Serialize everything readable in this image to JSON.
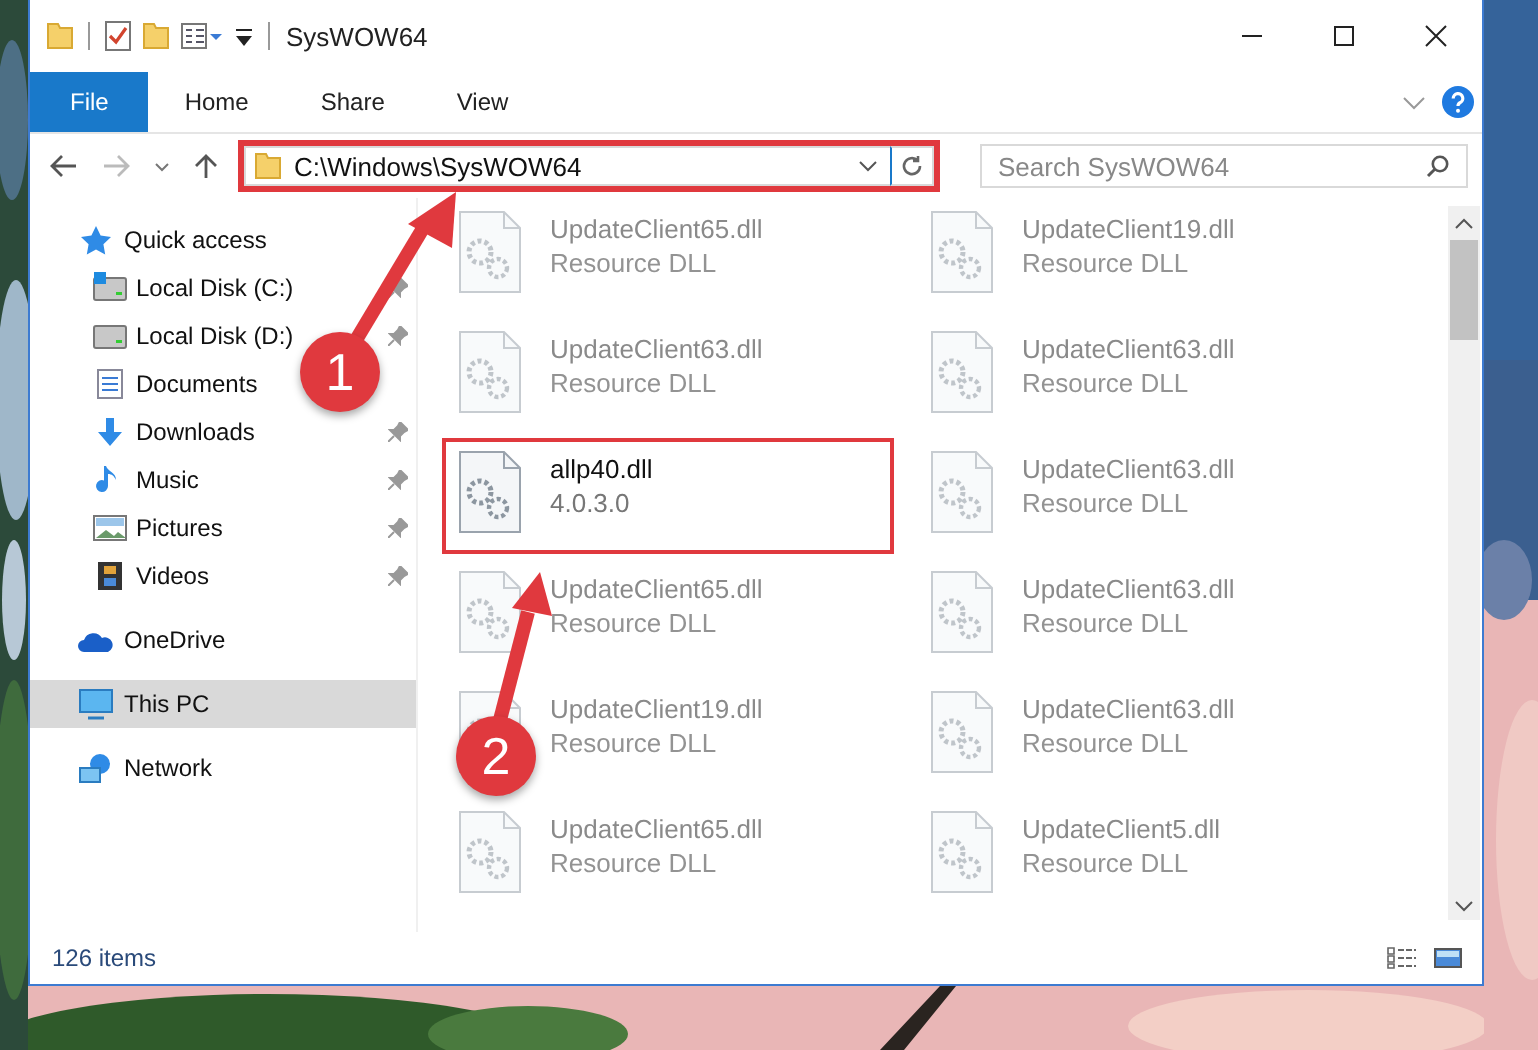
{
  "window": {
    "title": "SysWOW64"
  },
  "ribbon": {
    "tabs": [
      {
        "label": "File",
        "selected": true
      },
      {
        "label": "Home",
        "selected": false
      },
      {
        "label": "Share",
        "selected": false
      },
      {
        "label": "View",
        "selected": false
      }
    ]
  },
  "address_bar": {
    "path": "C:\\Windows\\SysWOW64",
    "highlighted": true
  },
  "search": {
    "placeholder": "Search SysWOW64"
  },
  "sidebar": {
    "items": [
      {
        "label": "Quick access",
        "kind": "star",
        "selected": false,
        "children": [
          {
            "label": "Local Disk (C:)",
            "kind": "system-drive",
            "pinned": true,
            "selected": false
          },
          {
            "label": "Local Disk (D:)",
            "kind": "drive",
            "pinned": true,
            "selected": false
          },
          {
            "label": "Documents",
            "kind": "documents",
            "pinned": false,
            "selected": false
          },
          {
            "label": "Downloads",
            "kind": "downloads",
            "pinned": true,
            "selected": false
          },
          {
            "label": "Music",
            "kind": "music",
            "pinned": true,
            "selected": false
          },
          {
            "label": "Pictures",
            "kind": "pictures",
            "pinned": true,
            "selected": false
          },
          {
            "label": "Videos",
            "kind": "videos",
            "pinned": true,
            "selected": false
          }
        ]
      },
      {
        "label": "OneDrive",
        "kind": "cloud",
        "selected": false
      },
      {
        "label": "This PC",
        "kind": "computer",
        "selected": true
      },
      {
        "label": "Network",
        "kind": "network",
        "selected": false
      }
    ]
  },
  "files": [
    {
      "name": "UpdateClient65.dll",
      "detail": "Resource DLL",
      "blurred": true,
      "highlighted": false
    },
    {
      "name": "UpdateClient19.dll",
      "detail": "Resource DLL",
      "blurred": true,
      "highlighted": false
    },
    {
      "name": "UpdateClient63.dll",
      "detail": "Resource DLL",
      "blurred": true,
      "highlighted": false
    },
    {
      "name": "UpdateClient63.dll",
      "detail": "Resource DLL",
      "blurred": true,
      "highlighted": false
    },
    {
      "name": "allp40.dll",
      "detail": "4.0.3.0",
      "blurred": false,
      "highlighted": true
    },
    {
      "name": "UpdateClient63.dll",
      "detail": "Resource DLL",
      "blurred": true,
      "highlighted": false
    },
    {
      "name": "UpdateClient65.dll",
      "detail": "Resource DLL",
      "blurred": true,
      "highlighted": false
    },
    {
      "name": "UpdateClient63.dll",
      "detail": "Resource DLL",
      "blurred": true,
      "highlighted": false
    },
    {
      "name": "UpdateClient19.dll",
      "detail": "Resource DLL",
      "blurred": true,
      "highlighted": false
    },
    {
      "name": "UpdateClient63.dll",
      "detail": "Resource DLL",
      "blurred": true,
      "highlighted": false
    },
    {
      "name": "UpdateClient65.dll",
      "detail": "Resource DLL",
      "blurred": true,
      "highlighted": false
    },
    {
      "name": "UpdateClient5.dll",
      "detail": "Resource DLL",
      "blurred": true,
      "highlighted": false
    }
  ],
  "status_bar": {
    "item_count": "126 items"
  },
  "callouts": [
    {
      "number": "1"
    },
    {
      "number": "2"
    }
  ]
}
